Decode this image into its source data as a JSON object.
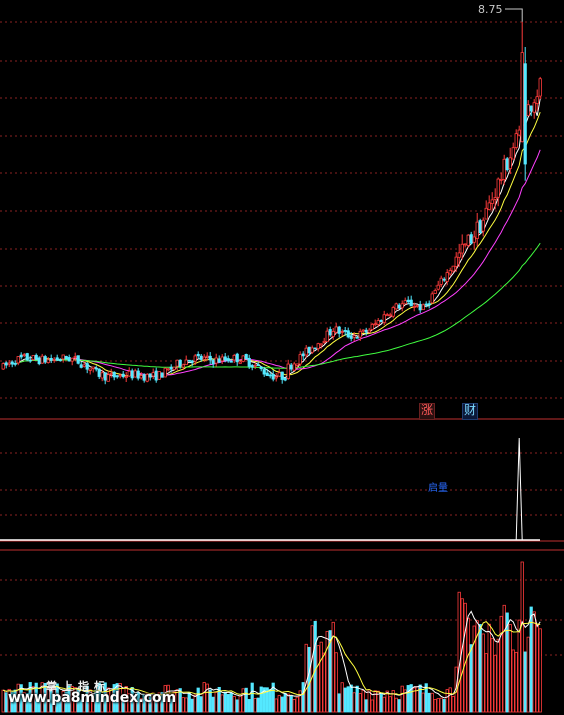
{
  "labels": {
    "price_high": "8.75",
    "zhang": "涨",
    "cai": "财",
    "signal_tag": "启量",
    "watermark_title": "掌上指标",
    "watermark_url": "www.pa8mindex.com"
  },
  "colors": {
    "up": "#ff3b3b",
    "down": "#54e8ff",
    "ma5": "#ffffff",
    "ma10": "#ffff40",
    "ma20": "#ff40ff",
    "ma60": "#40ff40",
    "grid": "#8a2222",
    "separator": "#c03030"
  },
  "chart_data": [
    {
      "type": "candlestick",
      "panel": "price",
      "ylim": [
        2.0,
        9.0
      ],
      "grid": true,
      "moving_averages": [
        "MA5",
        "MA10",
        "MA20",
        "MA60"
      ],
      "max_label": 8.75,
      "base_price": 2.55,
      "note": "synthetic reconstruction of 180 daily bars"
    },
    {
      "type": "line",
      "panel": "signal",
      "series": [
        {
          "values_at_bars": [
            [
              171,
              0
            ],
            [
              172,
              1
            ],
            [
              173,
              0
            ]
          ]
        }
      ],
      "tag": "启量"
    },
    {
      "type": "bar",
      "panel": "volume",
      "series": [
        {
          "name": "VOL"
        },
        {
          "name": "MAVOL"
        }
      ]
    }
  ]
}
